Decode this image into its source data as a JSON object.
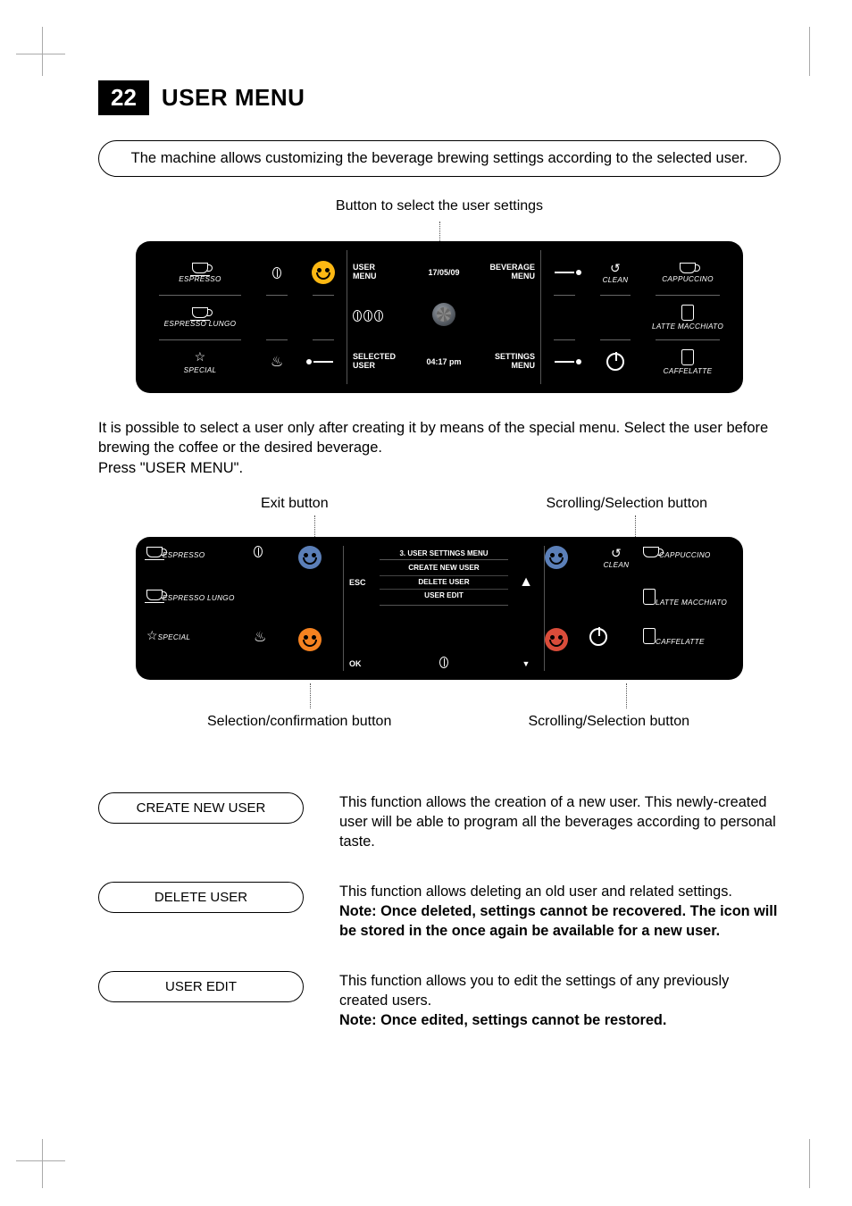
{
  "page_number": "22",
  "page_title": "USER MENU",
  "intro": "The machine allows customizing the beverage brewing settings according to the selected user.",
  "screen1": {
    "caption_top": "Button to select the user settings",
    "left_labels": [
      "ESPRESSO",
      "ESPRESSO LUNGO",
      "SPECIAL"
    ],
    "right_labels": [
      "CAPPUCCINO",
      "LATTE MACCHIATO",
      "CAFFELATTE"
    ],
    "clean_label": "CLEAN",
    "center": {
      "date": "17/05/09",
      "time": "04:17 pm",
      "user_menu": "USER\nMENU",
      "beverage_menu": "BEVERAGE\nMENU",
      "selected_user": "SELECTED\nUSER",
      "settings_menu": "SETTINGS\nMENU"
    }
  },
  "body1": "It is possible to select a user only after creating it by means of the special menu. Select the user before brewing the coffee or the desired beverage.",
  "body2": "Press \"USER MENU\".",
  "screen2": {
    "caption_tl": "Exit button",
    "caption_tr": "Scrolling/Selection button",
    "caption_bl": "Selection/confirmation button",
    "caption_br": "Scrolling/Selection button",
    "menu_title": "3. USER SETTINGS MENU",
    "esc": "ESC",
    "ok": "OK",
    "items": [
      "CREATE NEW USER",
      "DELETE USER",
      "USER EDIT"
    ],
    "left_labels": [
      "ESPRESSO",
      "ESPRESSO LUNGO",
      "SPECIAL"
    ],
    "right_labels": [
      "CAPPUCCINO",
      "LATTE MACCHIATO",
      "CAFFELATTE"
    ],
    "clean_label": "CLEAN"
  },
  "options": {
    "create": {
      "label": "CREATE NEW USER",
      "desc": "This function allows the creation of a new user. This newly-created user will be able to program all the beverages according to personal taste."
    },
    "delete": {
      "label": "DELETE USER",
      "desc": "This function allows deleting an old user and related settings.",
      "note": "Note: Once deleted, settings cannot be recovered. The icon will be stored in the once again be available for a new user."
    },
    "edit": {
      "label": "USER EDIT",
      "desc": "This function allows you to edit the settings of any previously created users.",
      "note": "Note: Once edited, settings cannot be restored."
    }
  }
}
